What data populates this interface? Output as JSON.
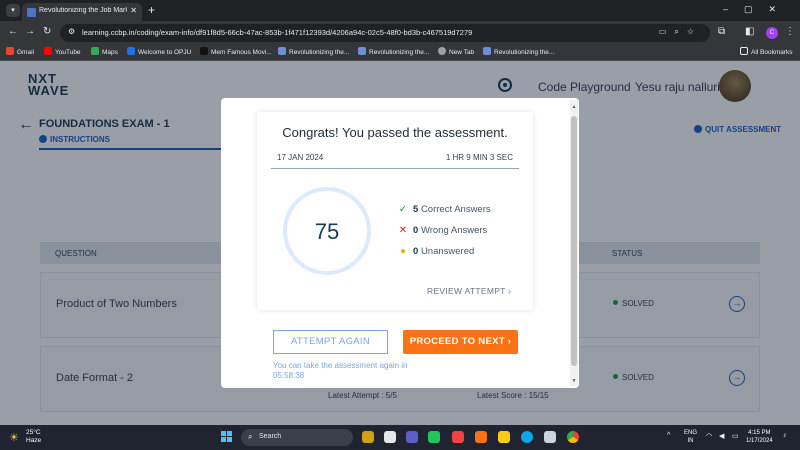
{
  "browser": {
    "tab_title": "Revolutionizing the Job Market",
    "url": "learning.ccbp.in/coding/exam-info/df91f8d5-66cb-47ac-853b-1f471f12393d/4206a94c-02c5-48f0-bd3b-c467519d7279",
    "bookmarks": [
      "Gmail",
      "YouTube",
      "Maps",
      "Welcome to OPJU",
      "Mem Famous Movi...",
      "Revolutionizing the...",
      "Revolutionizing the...",
      "New Tab",
      "Revolutionizing the..."
    ],
    "all_bookmarks": "All Bookmarks",
    "profile_initial": "C"
  },
  "header": {
    "logo_line1": "NXT",
    "logo_line2": "WAVE",
    "code_playground": "Code Playground",
    "user_name": "Yesu raju nalluri"
  },
  "exam": {
    "title": "FOUNDATIONS EXAM - 1",
    "instructions_tab": "INSTRUCTIONS",
    "quit": "QUIT ASSESSMENT"
  },
  "table": {
    "col_question": "QUESTION",
    "col_status": "STATUS",
    "rows": [
      {
        "question": "Product of Two Numbers",
        "status": "SOLVED"
      },
      {
        "question": "Date Format - 2",
        "status": "SOLVED"
      }
    ],
    "latest_attempt": "Latest Attempt : 5/5",
    "latest_score": "Latest Score : 15/15"
  },
  "modal": {
    "heading": "Congrats! You passed the assessment.",
    "date": "17 JAN 2024",
    "duration": "1 HR 9 MIN 3 SEC",
    "score": "75",
    "correct_count": "5",
    "correct_label": "Correct Answers",
    "wrong_count": "0",
    "wrong_label": "Wrong Answers",
    "unanswered_count": "0",
    "unanswered_label": "Unanswered",
    "review_label": "REVIEW ATTEMPT",
    "attempt_again_label": "ATTEMPT AGAIN",
    "proceed_label": "PROCEED TO NEXT",
    "retake_note": "You can take the assessment again in 05:58:38"
  },
  "taskbar": {
    "temperature": "25°C",
    "weather": "Haze",
    "search_label": "Search",
    "lang_line1": "ENG",
    "lang_line2": "IN",
    "time": "4:15 PM",
    "date": "1/17/2024"
  },
  "colors": {
    "brand_navy": "#183B56",
    "accent_blue": "#1E5FC3",
    "proceed_orange": "#F97316",
    "correct_green": "#16A34A",
    "wrong_red": "#DC2626",
    "unanswered_yellow": "#EAB308"
  }
}
